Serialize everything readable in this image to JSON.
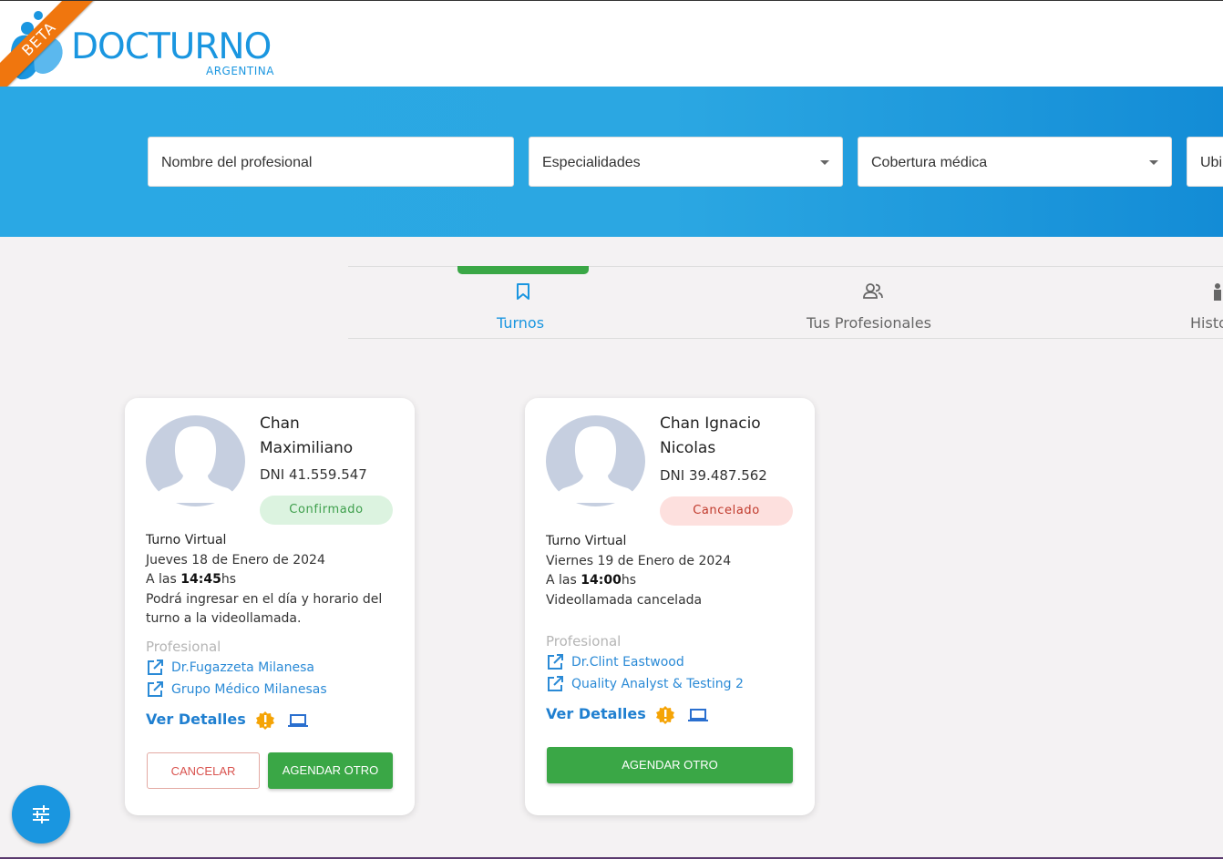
{
  "brand": {
    "name": "DOCTURNO",
    "sub": "ARGENTINA",
    "beta": "BETA",
    "color": "#1a96e0"
  },
  "search": {
    "name_placeholder": "Nombre del profesional",
    "specialty": "Especialidades",
    "coverage": "Cobertura médica",
    "location": "Ubi"
  },
  "tabs": [
    {
      "label": "Turnos",
      "icon": "bookmark-icon",
      "active": true
    },
    {
      "label": "Tus Profesionales",
      "icon": "people-icon",
      "active": false
    },
    {
      "label": "Histo",
      "icon": "history-icon",
      "active": false
    }
  ],
  "cards": [
    {
      "name": "Chan Maximiliano",
      "dni": "DNI 41.559.547",
      "status": "Confirmado",
      "type": "Turno Virtual",
      "date": "Jueves 18 de Enero de 2024",
      "time_prefix": "A las ",
      "time": "14:45",
      "time_suffix": "hs",
      "note": "Podrá ingresar en el día y horario del turno a la videollamada.",
      "prof_title": "Profesional",
      "doctor": "Dr.Fugazzeta Milanesa",
      "group": "Grupo Médico Milanesas",
      "details": "Ver Detalles",
      "cancel": "CANCELAR",
      "book": "AGENDAR OTRO"
    },
    {
      "name": "Chan Ignacio Nicolas",
      "dni": "DNI 39.487.562",
      "status": "Cancelado",
      "type": "Turno Virtual",
      "date": "Viernes 19 de Enero de 2024",
      "time_prefix": "A las ",
      "time": "14:00",
      "time_suffix": "hs",
      "note": "Videollamada cancelada",
      "prof_title": "Profesional",
      "doctor": "Dr.Clint Eastwood",
      "group": "Quality Analyst & Testing 2",
      "details": "Ver Detalles",
      "book": "AGENDAR OTRO"
    }
  ],
  "fab": {
    "icon": "filter-sliders-icon"
  }
}
